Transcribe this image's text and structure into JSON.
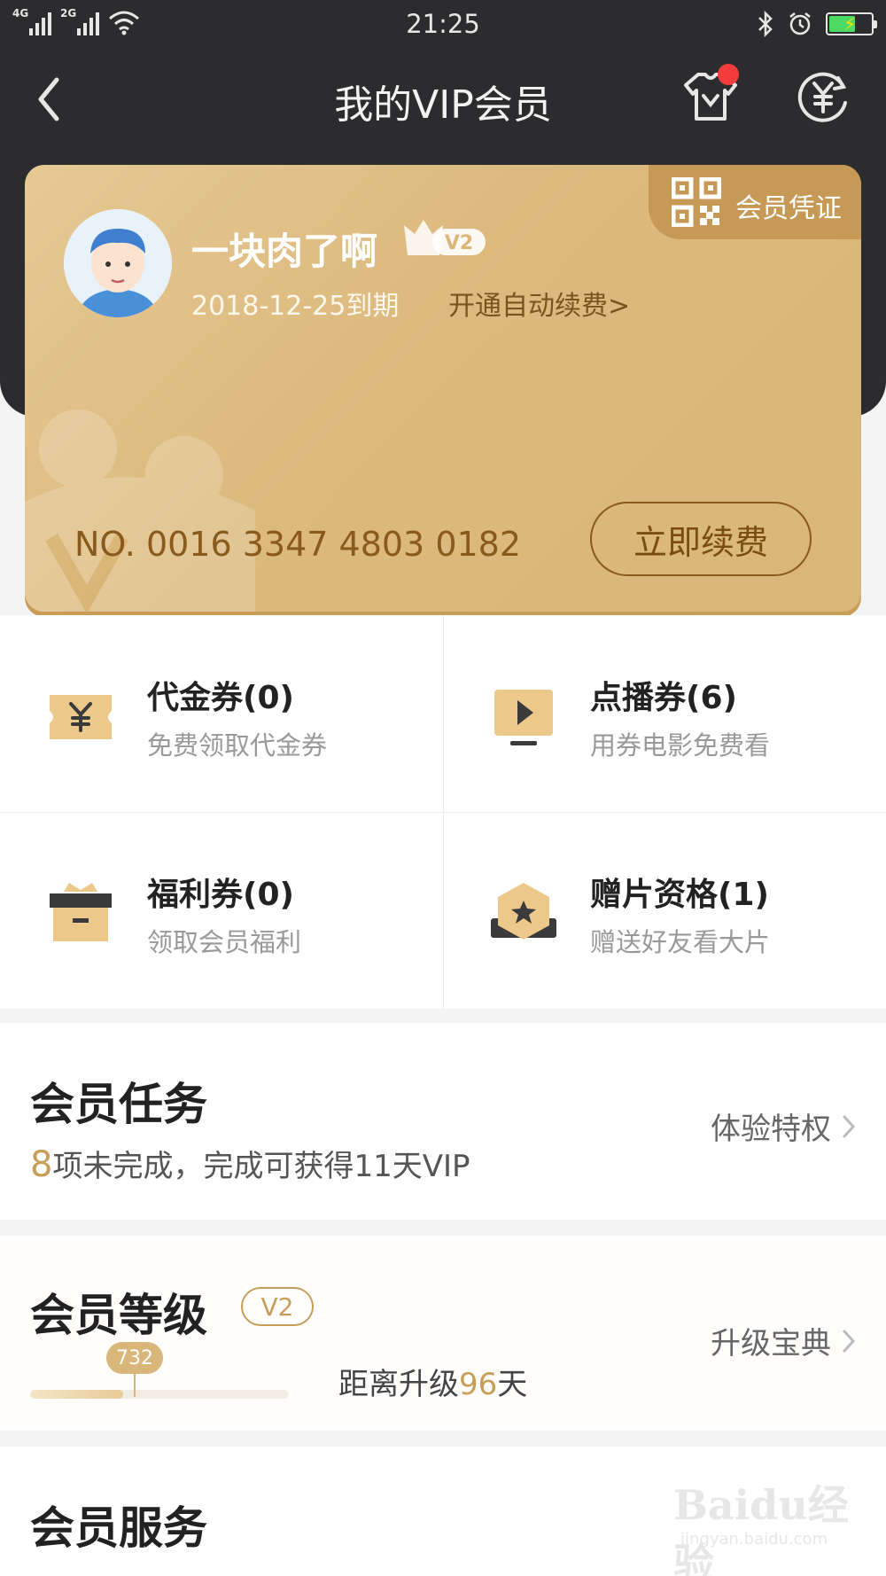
{
  "status_bar": {
    "network_1": "4G",
    "network_2": "2G",
    "time": "21:25"
  },
  "nav": {
    "title": "我的VIP会员",
    "icons": [
      "back-chevron-icon",
      "tshirt-icon",
      "yuan-exchange-icon"
    ]
  },
  "card": {
    "qr_label": "会员凭证",
    "username": "一块肉了啊",
    "vip_level": "V2",
    "expire": "2018-12-25到期",
    "auto_renew": "开通自动续费>",
    "card_no": "NO. 0016 3347 4803 0182",
    "renew_button": "立即续费"
  },
  "benefits": [
    {
      "title": "代金券(0)",
      "subtitle": "免费领取代金券",
      "icon": "yuan-ticket-icon"
    },
    {
      "title": "点播券(6)",
      "subtitle": "用券电影免费看",
      "icon": "play-screen-icon"
    },
    {
      "title": "福利券(0)",
      "subtitle": "领取会员福利",
      "icon": "gift-box-icon"
    },
    {
      "title": "赠片资格(1)",
      "subtitle": "赠送好友看大片",
      "icon": "star-hexagon-icon"
    }
  ],
  "tasks": {
    "title": "会员任务",
    "link": "体验特权",
    "count": "8",
    "desc": "项未完成，完成可获得11天VIP"
  },
  "level": {
    "title": "会员等级",
    "badge": "V2",
    "link": "升级宝典",
    "points": "732",
    "progress": 0.36,
    "text_prefix": "距离升级",
    "days": "96",
    "text_suffix": "天"
  },
  "service": {
    "title": "会员服务"
  },
  "watermark": {
    "brand": "Baidu经验",
    "url": "jingyan.baidu.com"
  },
  "colors": {
    "header_bg": "#2c2c2e",
    "gold": "#d9b67a",
    "accent": "#c89d57"
  }
}
